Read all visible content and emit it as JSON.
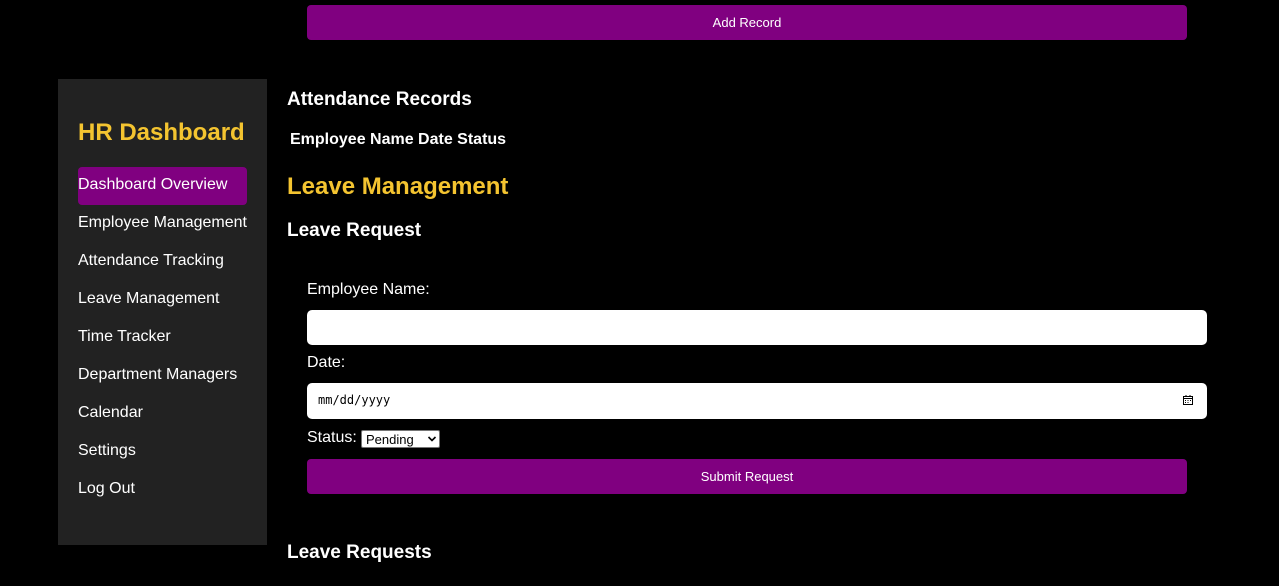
{
  "top": {
    "add_record_label": "Add Record"
  },
  "sidebar": {
    "title": "HR Dashboard",
    "items": [
      {
        "label": "Dashboard Overview",
        "active": true
      },
      {
        "label": "Employee Management",
        "active": false
      },
      {
        "label": "Attendance Tracking",
        "active": false
      },
      {
        "label": "Leave Management",
        "active": false
      },
      {
        "label": "Time Tracker",
        "active": false
      },
      {
        "label": "Department Managers",
        "active": false
      },
      {
        "label": "Calendar",
        "active": false
      },
      {
        "label": "Settings",
        "active": false
      },
      {
        "label": "Log Out",
        "active": false
      }
    ]
  },
  "attendance": {
    "title": "Attendance Records",
    "columns_text": "Employee Name Date Status"
  },
  "leave": {
    "title": "Leave Management",
    "request_title": "Leave Request",
    "form": {
      "name_label": "Employee Name:",
      "name_value": "",
      "date_label": "Date:",
      "date_placeholder": "mm/dd/yyyy",
      "status_label": "Status:",
      "status_value": "Pending",
      "submit_label": "Submit Request"
    },
    "requests_title": "Leave Requests"
  },
  "colors": {
    "accent": "#800080",
    "heading_gold": "#f4c430",
    "sidebar_bg": "#222222",
    "page_bg": "#000000"
  },
  "icons": {
    "date_picker": "calendar-icon",
    "select": "chevron-down-icon"
  }
}
